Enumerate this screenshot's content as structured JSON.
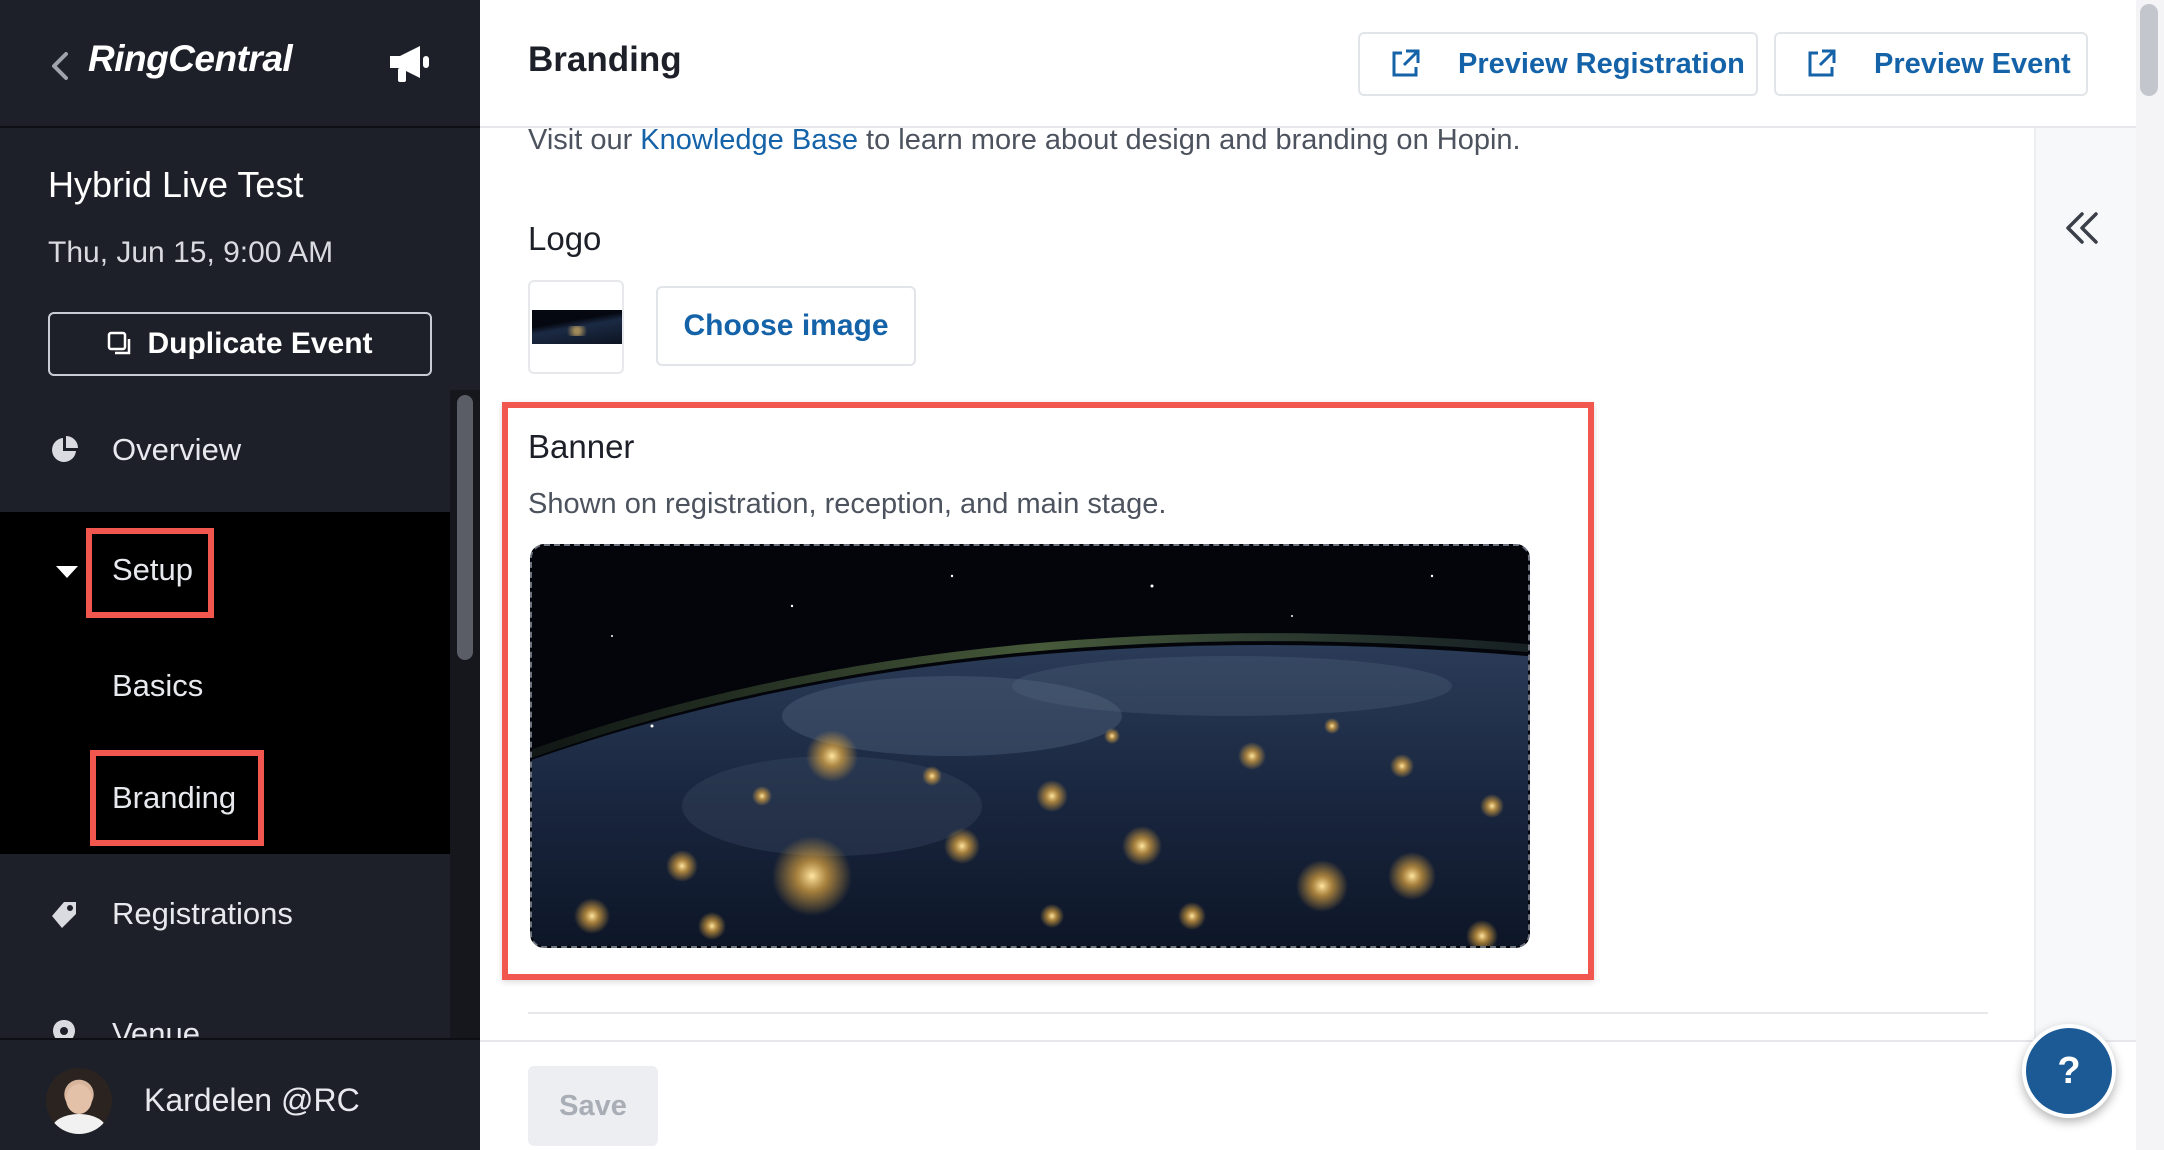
{
  "sidebar": {
    "brand": "RingCentral",
    "event_title": "Hybrid Live Test",
    "event_date": "Thu, Jun 15, 9:00 AM",
    "duplicate_label": "Duplicate Event",
    "nav": {
      "overview": "Overview",
      "setup": "Setup",
      "basics": "Basics",
      "branding": "Branding",
      "registrations": "Registrations",
      "venue": "Venue"
    },
    "user_name": "Kardelen @RC"
  },
  "header": {
    "title": "Branding",
    "preview_registration": "Preview Registration",
    "preview_event": "Preview Event"
  },
  "main": {
    "kb_prefix": "Visit our ",
    "kb_link": "Knowledge Base",
    "kb_suffix": " to learn more about design and branding on Hopin.",
    "logo_label": "Logo",
    "choose_image": "Choose image",
    "banner_label": "Banner",
    "banner_desc": "Shown on registration, reception, and main stage."
  },
  "footer": {
    "save_label": "Save"
  },
  "help_label": "?",
  "colors": {
    "sidebar_bg": "#1d2028",
    "accent": "#1462a8",
    "highlight": "#f1574f",
    "help_bg": "#1c5a96"
  }
}
